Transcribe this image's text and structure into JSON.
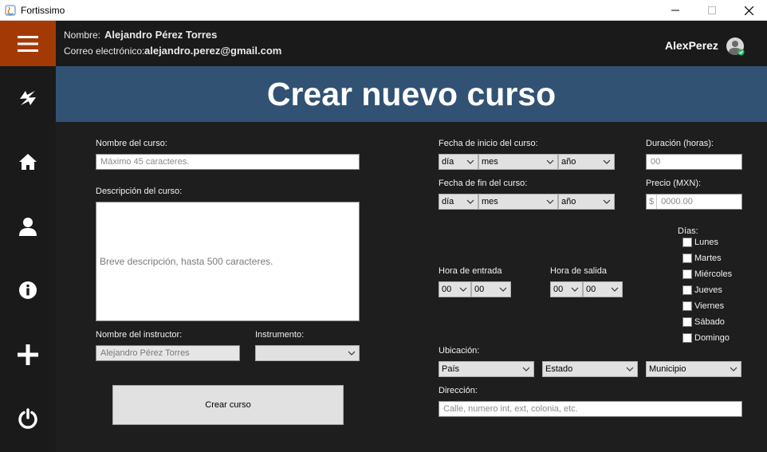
{
  "window": {
    "title": "Fortissimo"
  },
  "header": {
    "name_label": "Nombre:",
    "name_value": "Alejandro Pérez Torres",
    "email_label": "Correo electrónico:",
    "email_value": "alejandro.perez@gmail.com",
    "username": "AlexPerez"
  },
  "sidebar": {
    "items": [
      "menu-icon",
      "swap-icon",
      "home-icon",
      "user-icon",
      "info-icon",
      "plus-icon",
      "power-icon"
    ],
    "accent_color": "#a33a06"
  },
  "banner": {
    "title": "Crear nuevo curso",
    "color": "#315273"
  },
  "form": {
    "course_name_label": "Nombre del curso:",
    "course_name_placeholder": "Máximo 45 caracteres.",
    "description_label": "Descripción del curso:",
    "description_placeholder": "Breve descripción, hasta 500 caracteres.",
    "instructor_label": "Nombre del instructor:",
    "instructor_value": "Alejandro Pérez Torres",
    "instrument_label": "Instrumento:",
    "instrument_value": "",
    "create_button": "Crear curso",
    "start_date_label": "Fecha de inicio del curso:",
    "end_date_label": "Fecha de fin del curso:",
    "day_value": "día",
    "month_value": "mes",
    "year_value": "año",
    "duration_label": "Duración (horas):",
    "duration_placeholder": "00",
    "price_label": "Precio (MXN):",
    "price_symbol": "$",
    "price_placeholder": "0000.00",
    "days_label": "Días:",
    "days": [
      "Lunes",
      "Martes",
      "Miércoles",
      "Jueves",
      "Viernes",
      "Sábado",
      "Domingo"
    ],
    "entry_time_label": "Hora de entrada",
    "exit_time_label": "Hora de salida",
    "time_value": "00",
    "location_label": "Ubicación:",
    "country_value": "País",
    "state_value": "Estado",
    "municipality_value": "Municipio",
    "address_label": "Dirección:",
    "address_placeholder": "Calle, numero int, ext, colonia, etc."
  }
}
